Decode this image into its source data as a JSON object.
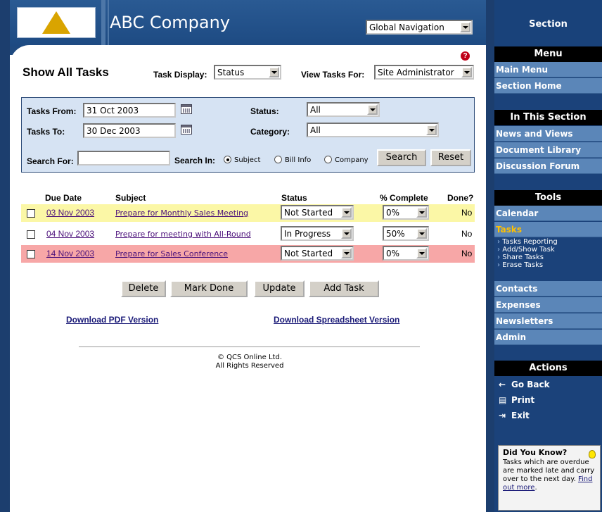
{
  "header": {
    "company": "ABC Company",
    "global_nav": "Global Navigation"
  },
  "page": {
    "title": "Show All Tasks",
    "task_display_label": "Task Display:",
    "task_display_value": "Status",
    "view_tasks_for_label": "View Tasks For:",
    "view_tasks_for_value": "Site Administrator"
  },
  "filters": {
    "tasks_from_label": "Tasks From:",
    "tasks_from_value": "31 Oct 2003",
    "tasks_to_label": "Tasks To:",
    "tasks_to_value": "30 Dec 2003",
    "status_label": "Status:",
    "status_value": "All",
    "category_label": "Category:",
    "category_value": "All",
    "search_for_label": "Search For:",
    "search_in_label": "Search In:",
    "search_in_options": [
      "Subject",
      "Bill Info",
      "Company"
    ],
    "search_in_selected": "Subject",
    "search_button": "Search",
    "reset_button": "Reset"
  },
  "table": {
    "headers": [
      "Due Date",
      "Subject",
      "Status",
      "% Complete",
      "Done?"
    ],
    "rows": [
      {
        "due": "03 Nov 2003",
        "subject": "Prepare for Monthly Sales Meeting",
        "status": "Not Started",
        "complete": "0%",
        "done": "No",
        "highlight": "yellow"
      },
      {
        "due": "04 Nov 2003",
        "subject": "Prepare for meeting with All-Round",
        "status": "In Progress",
        "complete": "50%",
        "done": "No",
        "highlight": "none"
      },
      {
        "due": "14 Nov 2003",
        "subject": "Prepare for Sales Conference",
        "status": "Not Started",
        "complete": "0%",
        "done": "No",
        "highlight": "red"
      }
    ]
  },
  "actions": {
    "delete": "Delete",
    "mark_done": "Mark Done",
    "update": "Update",
    "add_task": "Add Task"
  },
  "downloads": {
    "pdf": "Download PDF Version",
    "spreadsheet": "Download Spreadsheet Version"
  },
  "footer": {
    "line1": "© QCS Online Ltd.",
    "line2": "All Rights Reserved"
  },
  "sidebar": {
    "section": "Section",
    "menu_head": "Menu",
    "menu_items": [
      "Main Menu",
      "Section Home"
    ],
    "in_section_head": "In This Section",
    "in_section_items": [
      "News and Views",
      "Document Library",
      "Discussion Forum"
    ],
    "tools_head": "Tools",
    "tools_items": [
      "Calendar",
      "Tasks",
      "Contacts",
      "Expenses",
      "Newsletters",
      "Admin"
    ],
    "tasks_sub": [
      "Tasks Reporting",
      "Add/Show Task",
      "Share Tasks",
      "Erase Tasks"
    ],
    "actions_head": "Actions",
    "actions_items": [
      {
        "label": "Go Back",
        "icon": "back-arrow-icon"
      },
      {
        "label": "Print",
        "icon": "printer-icon"
      },
      {
        "label": "Exit",
        "icon": "exit-door-icon"
      }
    ],
    "did_you_know_title": "Did You Know?",
    "did_you_know_text": "Tasks which are overdue are marked late and carry over to the next day.",
    "did_you_know_link": "Find out more"
  },
  "colors": {
    "row_yellow": "#fbf7a6",
    "row_red": "#f7a7a7",
    "sidebar_item": "#5b86b8",
    "active_tool": "#ffc000"
  }
}
